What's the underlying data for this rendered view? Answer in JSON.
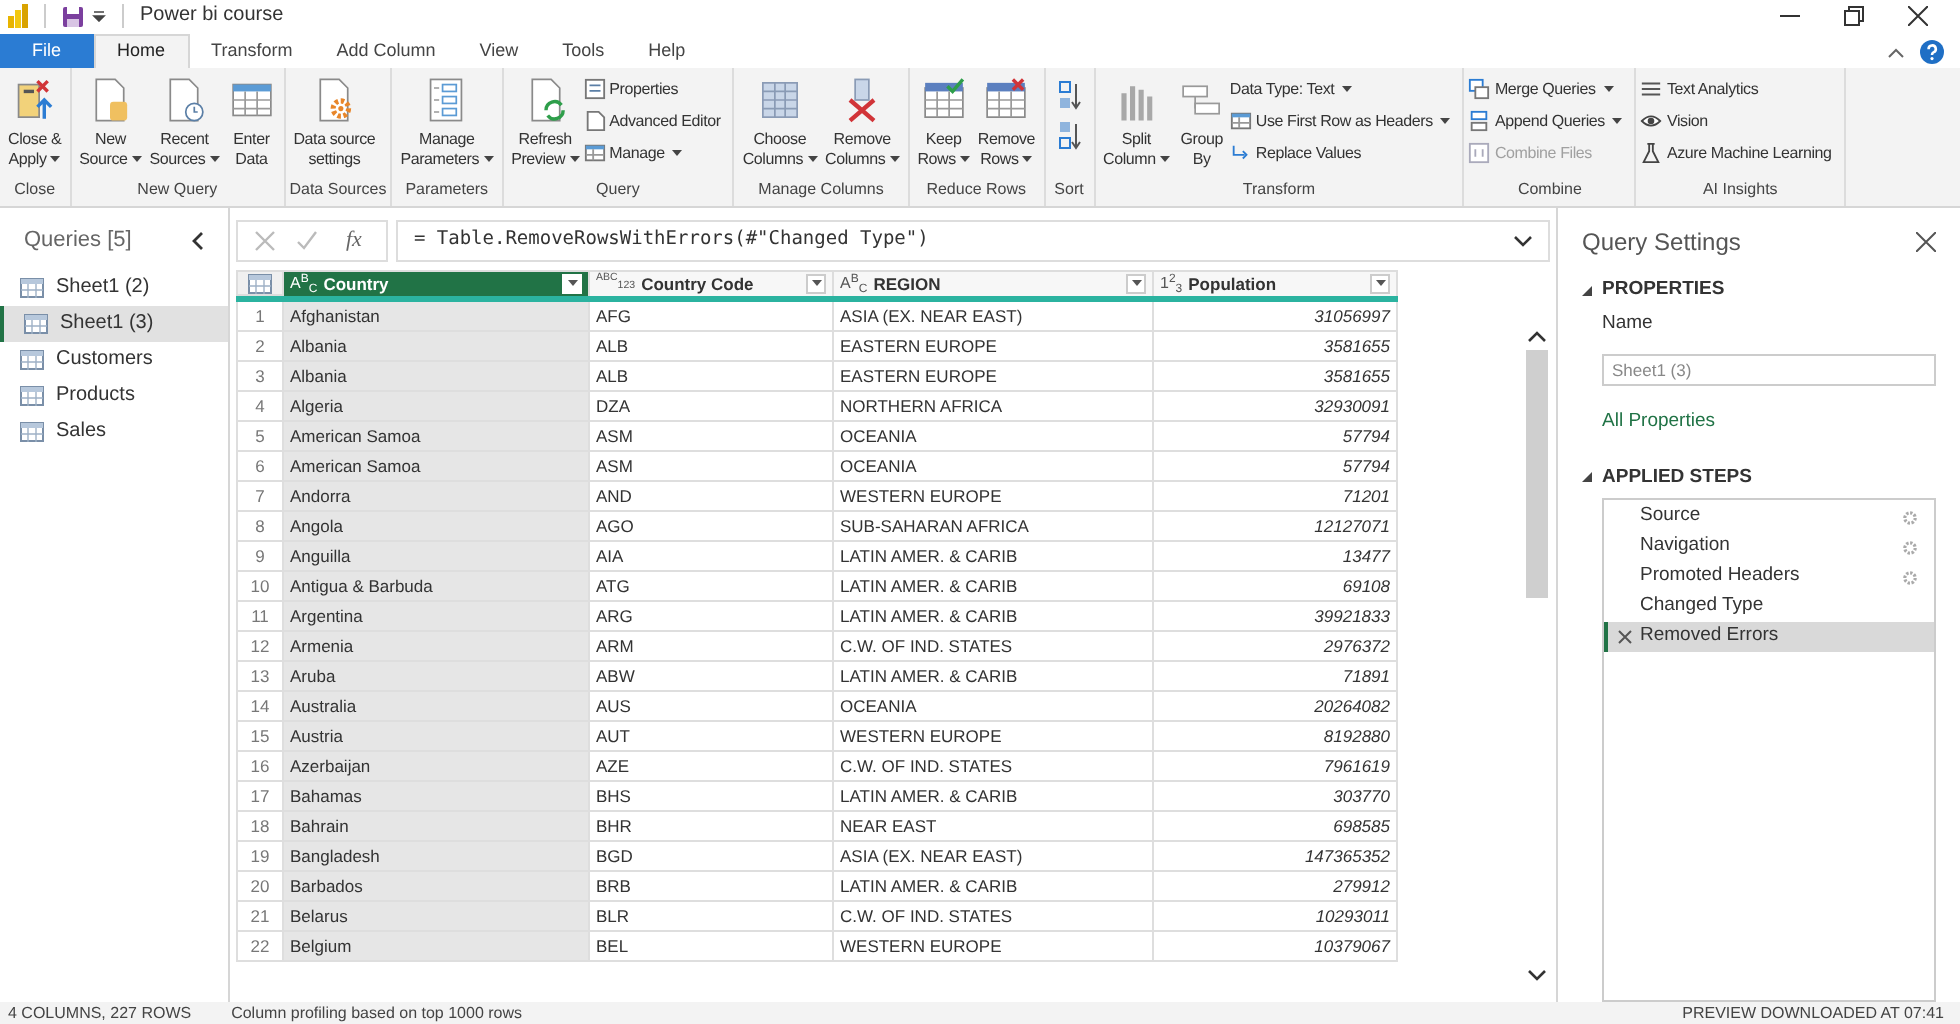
{
  "window": {
    "title": "Power bi course"
  },
  "tabs": [
    {
      "label": "File",
      "kind": "file",
      "selected": false
    },
    {
      "label": "Home",
      "kind": "tab",
      "selected": true
    },
    {
      "label": "Transform",
      "kind": "tab",
      "selected": false
    },
    {
      "label": "Add Column",
      "kind": "tab",
      "selected": false
    },
    {
      "label": "View",
      "kind": "tab",
      "selected": false
    },
    {
      "label": "Tools",
      "kind": "tab",
      "selected": false
    },
    {
      "label": "Help",
      "kind": "tab",
      "selected": false
    }
  ],
  "ribbon_groups": [
    {
      "label": "Close",
      "items": [
        {
          "kind": "large",
          "lines": [
            "Close &",
            "Apply"
          ],
          "dropdown": true
        }
      ]
    },
    {
      "label": "New Query",
      "items": [
        {
          "kind": "large",
          "lines": [
            "New",
            "Source"
          ],
          "dropdown": true
        },
        {
          "kind": "large",
          "lines": [
            "Recent",
            "Sources"
          ],
          "dropdown": true
        },
        {
          "kind": "large",
          "lines": [
            "Enter",
            "Data"
          ],
          "dropdown": false
        }
      ]
    },
    {
      "label": "Data Sources",
      "items": [
        {
          "kind": "large",
          "lines": [
            "Data source",
            "settings"
          ],
          "dropdown": false
        }
      ]
    },
    {
      "label": "Parameters",
      "items": [
        {
          "kind": "large",
          "lines": [
            "Manage",
            "Parameters"
          ],
          "dropdown": true
        }
      ]
    },
    {
      "label": "Query",
      "items": [
        {
          "kind": "large",
          "lines": [
            "Refresh",
            "Preview"
          ],
          "dropdown": true
        },
        {
          "kind": "stack",
          "items": [
            {
              "label": "Properties",
              "dropdown": false,
              "disabled": false
            },
            {
              "label": "Advanced Editor",
              "dropdown": false,
              "disabled": false
            },
            {
              "label": "Manage",
              "dropdown": true,
              "disabled": false
            }
          ]
        }
      ]
    },
    {
      "label": "Manage Columns",
      "items": [
        {
          "kind": "large",
          "lines": [
            "Choose",
            "Columns"
          ],
          "dropdown": true
        },
        {
          "kind": "large",
          "lines": [
            "Remove",
            "Columns"
          ],
          "dropdown": true
        }
      ]
    },
    {
      "label": "Reduce Rows",
      "items": [
        {
          "kind": "large",
          "lines": [
            "Keep",
            "Rows"
          ],
          "dropdown": true
        },
        {
          "kind": "large",
          "lines": [
            "Remove",
            "Rows"
          ],
          "dropdown": true
        }
      ]
    },
    {
      "label": "Sort",
      "items": [
        {
          "kind": "sort"
        }
      ]
    },
    {
      "label": "Transform",
      "items": [
        {
          "kind": "large",
          "lines": [
            "Split",
            "Column"
          ],
          "dropdown": true
        },
        {
          "kind": "large",
          "lines": [
            "Group",
            "By"
          ],
          "dropdown": false
        },
        {
          "kind": "stack",
          "items": [
            {
              "label": "Data Type: Text",
              "dropdown": true,
              "disabled": false
            },
            {
              "label": "Use First Row as Headers",
              "dropdown": true,
              "disabled": false
            },
            {
              "label": "Replace Values",
              "dropdown": false,
              "disabled": false
            }
          ]
        }
      ]
    },
    {
      "label": "Combine",
      "items": [
        {
          "kind": "stack",
          "items": [
            {
              "label": "Merge Queries",
              "dropdown": true,
              "disabled": false
            },
            {
              "label": "Append Queries",
              "dropdown": true,
              "disabled": false
            },
            {
              "label": "Combine Files",
              "dropdown": false,
              "disabled": true
            }
          ]
        }
      ]
    },
    {
      "label": "AI Insights",
      "items": [
        {
          "kind": "stack",
          "items": [
            {
              "label": "Text Analytics",
              "dropdown": false,
              "disabled": false
            },
            {
              "label": "Vision",
              "dropdown": false,
              "disabled": false
            },
            {
              "label": "Azure Machine Learning",
              "dropdown": false,
              "disabled": false
            }
          ]
        }
      ]
    }
  ],
  "queries": {
    "title": "Queries [5]",
    "items": [
      {
        "label": "Sheet1 (2)",
        "selected": false
      },
      {
        "label": "Sheet1 (3)",
        "selected": true
      },
      {
        "label": "Customers",
        "selected": false
      },
      {
        "label": "Products",
        "selected": false
      },
      {
        "label": "Sales",
        "selected": false
      }
    ]
  },
  "formula_bar": {
    "fx_label": "fx",
    "formula": "= Table.RemoveRowsWithErrors(#\"Changed Type\")"
  },
  "table": {
    "columns": [
      {
        "name": "Country",
        "kind": "text",
        "type_label": "A$^{B}$$_{C}$",
        "selected": true
      },
      {
        "name": "Country Code",
        "kind": "any",
        "type_label": "$^{ABC}$$_{123}$",
        "selected": false
      },
      {
        "name": "REGION",
        "kind": "text",
        "type_label": "A$^{B}$$_{C}$",
        "selected": false
      },
      {
        "name": "Population",
        "kind": "number",
        "type_label": "1$^{2}$$_{3}$",
        "selected": false
      }
    ],
    "rows": [
      {
        "number": "1",
        "cells": [
          "Afghanistan",
          "AFG",
          "ASIA (EX. NEAR EAST)",
          "31056997"
        ]
      },
      {
        "number": "2",
        "cells": [
          "Albania",
          "ALB",
          "EASTERN EUROPE",
          "3581655"
        ]
      },
      {
        "number": "3",
        "cells": [
          "Albania",
          "ALB",
          "EASTERN EUROPE",
          "3581655"
        ]
      },
      {
        "number": "4",
        "cells": [
          "Algeria",
          "DZA",
          "NORTHERN AFRICA",
          "32930091"
        ]
      },
      {
        "number": "5",
        "cells": [
          "American Samoa",
          "ASM",
          "OCEANIA",
          "57794"
        ]
      },
      {
        "number": "6",
        "cells": [
          "American Samoa",
          "ASM",
          "OCEANIA",
          "57794"
        ]
      },
      {
        "number": "7",
        "cells": [
          "Andorra",
          "AND",
          "WESTERN EUROPE",
          "71201"
        ]
      },
      {
        "number": "8",
        "cells": [
          "Angola",
          "AGO",
          "SUB-SAHARAN AFRICA",
          "12127071"
        ]
      },
      {
        "number": "9",
        "cells": [
          "Anguilla",
          "AIA",
          "LATIN AMER. & CARIB",
          "13477"
        ]
      },
      {
        "number": "10",
        "cells": [
          "Antigua & Barbuda",
          "ATG",
          "LATIN AMER. & CARIB",
          "69108"
        ]
      },
      {
        "number": "11",
        "cells": [
          "Argentina",
          "ARG",
          "LATIN AMER. & CARIB",
          "39921833"
        ]
      },
      {
        "number": "12",
        "cells": [
          "Armenia",
          "ARM",
          "C.W. OF IND. STATES",
          "2976372"
        ]
      },
      {
        "number": "13",
        "cells": [
          "Aruba",
          "ABW",
          "LATIN AMER. & CARIB",
          "71891"
        ]
      },
      {
        "number": "14",
        "cells": [
          "Australia",
          "AUS",
          "OCEANIA",
          "20264082"
        ]
      },
      {
        "number": "15",
        "cells": [
          "Austria",
          "AUT",
          "WESTERN EUROPE",
          "8192880"
        ]
      },
      {
        "number": "16",
        "cells": [
          "Azerbaijan",
          "AZE",
          "C.W. OF IND. STATES",
          "7961619"
        ]
      },
      {
        "number": "17",
        "cells": [
          "Bahamas",
          "BHS",
          "LATIN AMER. & CARIB",
          "303770"
        ]
      },
      {
        "number": "18",
        "cells": [
          "Bahrain",
          "BHR",
          "NEAR EAST",
          "698585"
        ]
      },
      {
        "number": "19",
        "cells": [
          "Bangladesh",
          "BGD",
          "ASIA (EX. NEAR EAST)",
          "147365352"
        ]
      },
      {
        "number": "20",
        "cells": [
          "Barbados",
          "BRB",
          "LATIN AMER. & CARIB",
          "279912"
        ]
      },
      {
        "number": "21",
        "cells": [
          "Belarus",
          "BLR",
          "C.W. OF IND. STATES",
          "10293011"
        ]
      },
      {
        "number": "22",
        "cells": [
          "Belgium",
          "BEL",
          "WESTERN EUROPE",
          "10379067"
        ]
      }
    ]
  },
  "query_settings": {
    "title": "Query Settings",
    "properties_heading": "PROPERTIES",
    "name_label": "Name",
    "name_value": "Sheet1 (3)",
    "all_properties_link": "All Properties",
    "steps_heading": "APPLIED STEPS",
    "steps": [
      {
        "label": "Source",
        "has_settings": true,
        "selected": false
      },
      {
        "label": "Navigation",
        "has_settings": true,
        "selected": false
      },
      {
        "label": "Promoted Headers",
        "has_settings": true,
        "selected": false
      },
      {
        "label": "Changed Type",
        "has_settings": false,
        "selected": false
      },
      {
        "label": "Removed Errors",
        "has_settings": false,
        "selected": true
      }
    ]
  },
  "status_bar": {
    "counts": "4 COLUMNS, 227 ROWS",
    "profiling": "Column profiling based on top 1000 rows",
    "preview": "PREVIEW DOWNLOADED AT 07:41"
  }
}
